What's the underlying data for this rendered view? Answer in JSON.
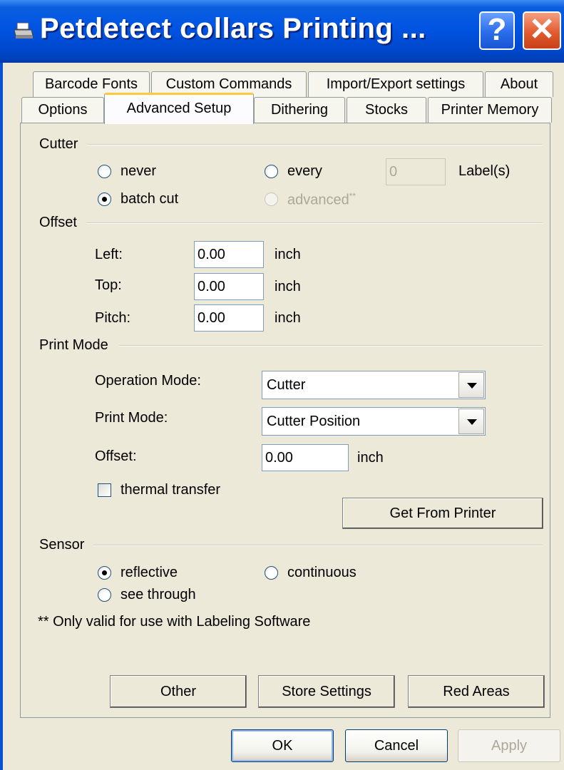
{
  "window": {
    "title": "Petdetect collars Printing ...",
    "help_label": "?",
    "close_label": "✕"
  },
  "tabs": {
    "row1": [
      "Barcode Fonts",
      "Custom Commands",
      "Import/Export settings",
      "About"
    ],
    "row2": [
      "Options",
      "Advanced Setup",
      "Dithering",
      "Stocks",
      "Printer Memory"
    ],
    "active": "Advanced Setup"
  },
  "cutter": {
    "title": "Cutter",
    "never": "never",
    "every": "every",
    "every_value": "0",
    "labels_suffix": "Label(s)",
    "batch_cut": "batch cut",
    "advanced": "advanced",
    "advanced_mark": "**",
    "selected": "batch cut"
  },
  "offset": {
    "title": "Offset",
    "left_label": "Left:",
    "left_value": "0.00",
    "top_label": "Top:",
    "top_value": "0.00",
    "pitch_label": "Pitch:",
    "pitch_value": "0.00",
    "unit": "inch"
  },
  "print_mode": {
    "title": "Print Mode",
    "operation_label": "Operation Mode:",
    "operation_value": "Cutter",
    "mode_label": "Print Mode:",
    "mode_value": "Cutter Position",
    "offset_label": "Offset:",
    "offset_value": "0.00",
    "unit": "inch",
    "thermal_transfer": "thermal transfer",
    "thermal_checked": false,
    "get_from_printer": "Get From Printer"
  },
  "sensor": {
    "title": "Sensor",
    "reflective": "reflective",
    "continuous": "continuous",
    "see_through": "see through",
    "selected": "reflective"
  },
  "footnote": "** Only valid for use with Labeling Software",
  "panel_buttons": {
    "other": "Other",
    "store_settings": "Store Settings",
    "red_areas": "Red Areas"
  },
  "dialog_buttons": {
    "ok": "OK",
    "cancel": "Cancel",
    "apply": "Apply"
  }
}
